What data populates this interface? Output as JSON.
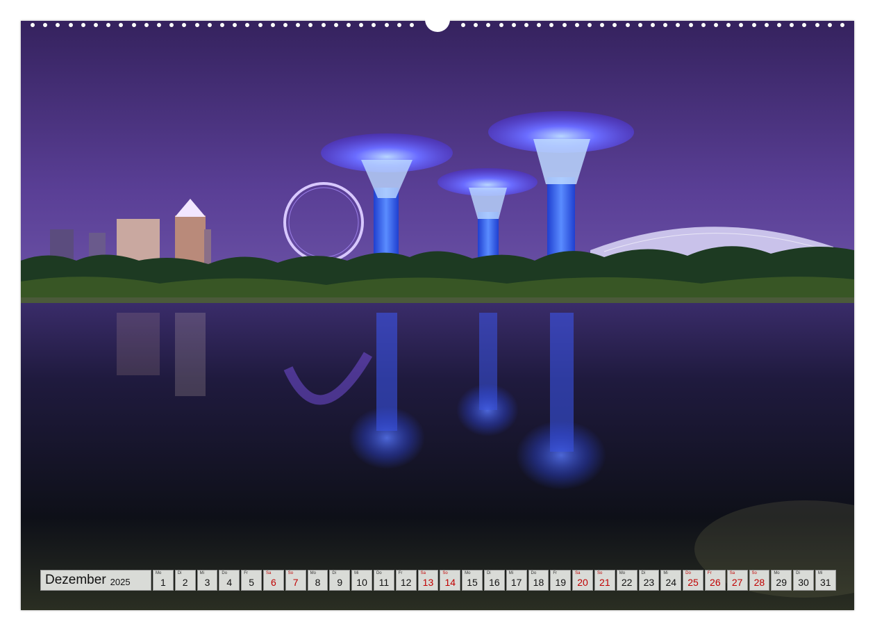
{
  "calendar": {
    "month": "Dezember",
    "year": "2025",
    "days": [
      {
        "wd": "Mo",
        "num": "1",
        "weekend": false
      },
      {
        "wd": "Di",
        "num": "2",
        "weekend": false
      },
      {
        "wd": "Mi",
        "num": "3",
        "weekend": false
      },
      {
        "wd": "Do",
        "num": "4",
        "weekend": false
      },
      {
        "wd": "Fr",
        "num": "5",
        "weekend": false
      },
      {
        "wd": "Sa",
        "num": "6",
        "weekend": true
      },
      {
        "wd": "So",
        "num": "7",
        "weekend": true
      },
      {
        "wd": "Mo",
        "num": "8",
        "weekend": false
      },
      {
        "wd": "Di",
        "num": "9",
        "weekend": false
      },
      {
        "wd": "Mi",
        "num": "10",
        "weekend": false
      },
      {
        "wd": "Do",
        "num": "11",
        "weekend": false
      },
      {
        "wd": "Fr",
        "num": "12",
        "weekend": false
      },
      {
        "wd": "Sa",
        "num": "13",
        "weekend": true
      },
      {
        "wd": "So",
        "num": "14",
        "weekend": true
      },
      {
        "wd": "Mo",
        "num": "15",
        "weekend": false
      },
      {
        "wd": "Di",
        "num": "16",
        "weekend": false
      },
      {
        "wd": "Mi",
        "num": "17",
        "weekend": false
      },
      {
        "wd": "Do",
        "num": "18",
        "weekend": false
      },
      {
        "wd": "Fr",
        "num": "19",
        "weekend": false
      },
      {
        "wd": "Sa",
        "num": "20",
        "weekend": true
      },
      {
        "wd": "So",
        "num": "21",
        "weekend": true
      },
      {
        "wd": "Mo",
        "num": "22",
        "weekend": false
      },
      {
        "wd": "Di",
        "num": "23",
        "weekend": false
      },
      {
        "wd": "Mi",
        "num": "24",
        "weekend": false
      },
      {
        "wd": "Do",
        "num": "25",
        "weekend": true
      },
      {
        "wd": "Fr",
        "num": "26",
        "weekend": true
      },
      {
        "wd": "Sa",
        "num": "27",
        "weekend": true
      },
      {
        "wd": "So",
        "num": "28",
        "weekend": true
      },
      {
        "wd": "Mo",
        "num": "29",
        "weekend": false
      },
      {
        "wd": "Di",
        "num": "30",
        "weekend": false
      },
      {
        "wd": "Mi",
        "num": "31",
        "weekend": false
      }
    ]
  },
  "colors": {
    "sky_top": "#3a2566",
    "sky_bottom": "#6a4fa8",
    "supertree_glow": "#3b5bff",
    "weekend_text": "#c00000",
    "cell_bg": "#d9dbd7"
  }
}
